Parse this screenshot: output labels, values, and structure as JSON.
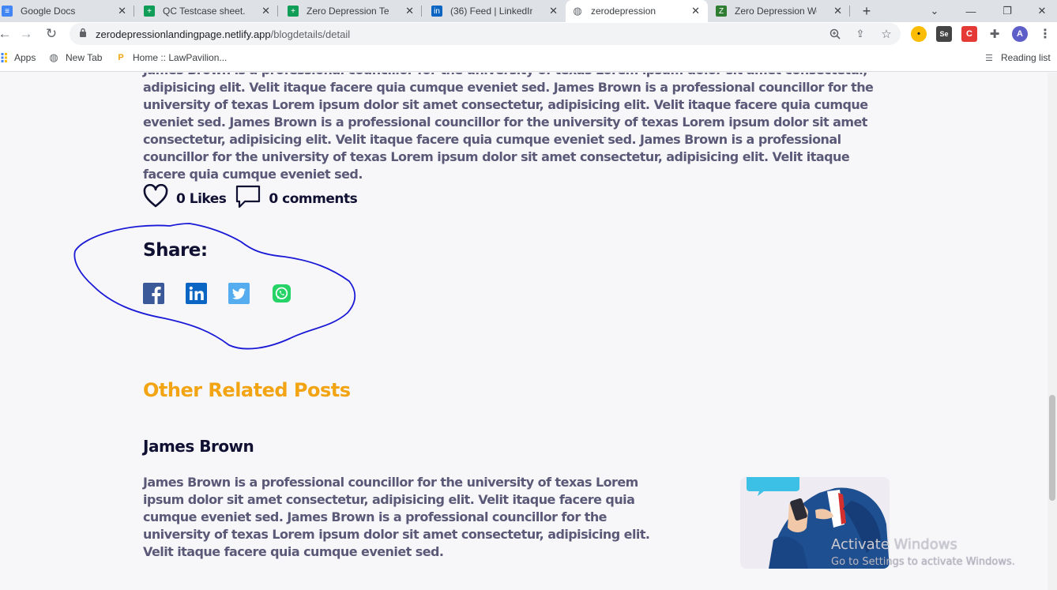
{
  "browser": {
    "tabs": [
      {
        "label": "Google Docs",
        "icon": "docs-icon"
      },
      {
        "label": "QC Testcase sheet.xlsx",
        "icon": "sheets-icon"
      },
      {
        "label": "Zero Depression Test C",
        "icon": "sheets-icon"
      },
      {
        "label": "(36) Feed | LinkedIn",
        "icon": "linkedin-icon"
      },
      {
        "label": "zerodepression",
        "icon": "globe-icon"
      },
      {
        "label": "Zero Depression Websi",
        "icon": "zd-icon"
      }
    ],
    "url_host": "zerodepressionlandingpage.netlify.app",
    "url_path": "/blogdetails/detail",
    "profile_initial": "A",
    "bookmarks": [
      {
        "label": "Apps"
      },
      {
        "label": "New Tab"
      },
      {
        "label": "Home :: LawPavilion..."
      }
    ],
    "reading_list": "Reading list"
  },
  "article": {
    "body": "James Brown is a professional councillor for the university of texas Lorem ipsum dolor sit amet consectetur, adipisicing elit. Velit itaque facere quia cumque eveniet sed. James Brown is a professional councillor for the university of texas Lorem ipsum dolor sit amet consectetur, adipisicing elit. Velit itaque facere quia cumque eveniet sed. James Brown is a professional councillor for the university of texas Lorem ipsum dolor sit amet consectetur, adipisicing elit. Velit itaque facere quia cumque eveniet sed. James Brown is a professional councillor for the university of texas Lorem ipsum dolor sit amet consectetur, adipisicing elit. Velit itaque facere quia cumque eveniet sed.",
    "likes": "0 Likes",
    "comments": "0 comments"
  },
  "share": {
    "title": "Share:",
    "networks": [
      "facebook",
      "linkedin",
      "twitter",
      "whatsapp"
    ]
  },
  "related": {
    "title": "Other Related Posts",
    "posts": [
      {
        "author": "James Brown",
        "excerpt": "James Brown is a professional councillor for the university of texas Lorem ipsum dolor sit amet consectetur, adipisicing elit. Velit itaque facere quia cumque eveniet sed. James Brown is a professional councillor for the university of texas Lorem ipsum dolor sit amet consectetur, adipisicing elit. Velit itaque facere quia cumque eveniet sed."
      }
    ]
  },
  "watermark": {
    "line1": "Activate Windows",
    "line2": "Go to Settings to activate Windows."
  },
  "colors": {
    "accent": "#f2a413",
    "heading": "#0f1032",
    "body_text": "#5a5a78",
    "facebook": "#3b5998",
    "linkedin": "#0a66c2",
    "twitter": "#55acee",
    "whatsapp": "#25d366",
    "annotation": "#1a1ad6"
  }
}
